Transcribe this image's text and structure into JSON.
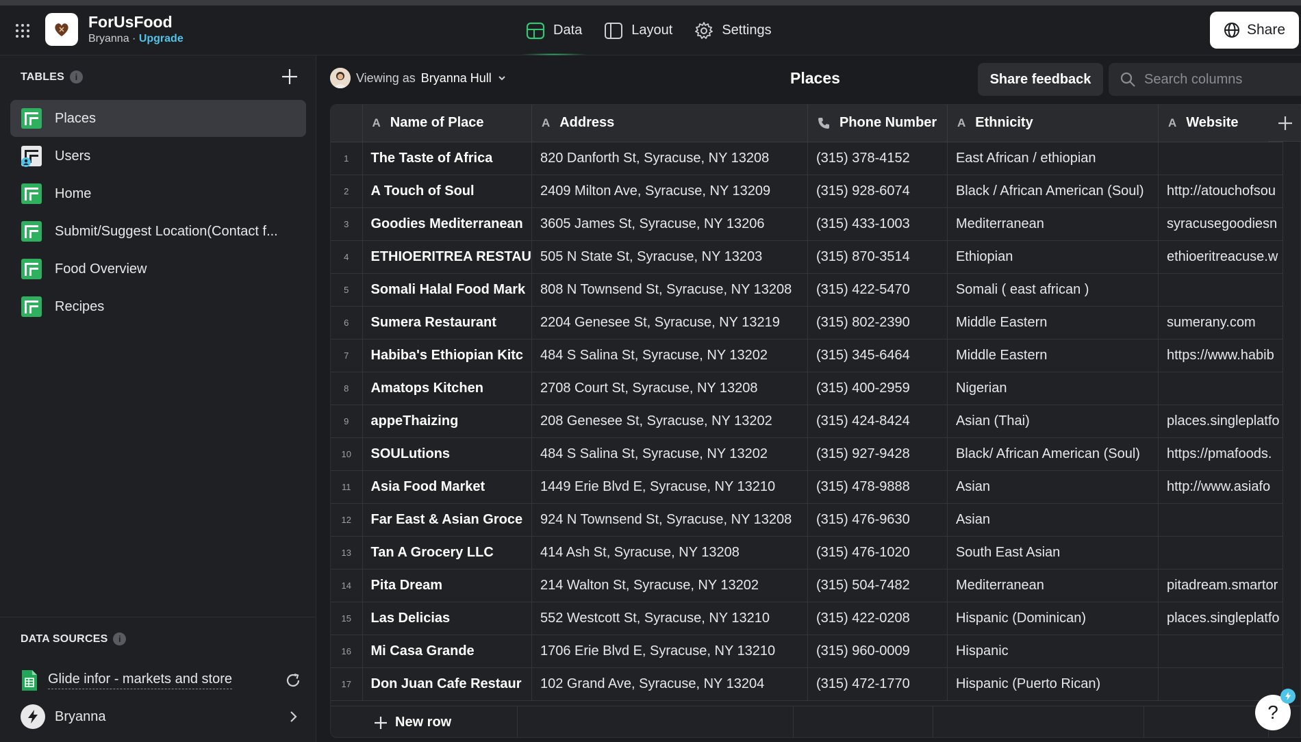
{
  "app": {
    "title": "ForUsFood",
    "user": "Bryanna",
    "separator": " · ",
    "upgrade_label": "Upgrade"
  },
  "nav": {
    "tabs": [
      {
        "label": "Data",
        "icon": "table-icon",
        "active": true
      },
      {
        "label": "Layout",
        "icon": "layout-icon",
        "active": false
      },
      {
        "label": "Settings",
        "icon": "gear-icon",
        "active": false
      }
    ],
    "share_label": "Share"
  },
  "sidebar": {
    "tables_heading": "TABLES",
    "tables": [
      {
        "label": "Places",
        "active": true
      },
      {
        "label": "Users",
        "active": false
      },
      {
        "label": "Home",
        "active": false
      },
      {
        "label": "Submit/Suggest Location(Contact f...",
        "active": false
      },
      {
        "label": "Food Overview",
        "active": false
      },
      {
        "label": "Recipes",
        "active": false
      }
    ],
    "data_sources_heading": "DATA SOURCES",
    "data_source": {
      "label": "Glide infor - markets and store",
      "icon": "google-sheets-icon"
    },
    "user_label": "Bryanna"
  },
  "main": {
    "viewing_prefix": "Viewing as ",
    "viewing_name": "Bryanna Hull",
    "page_title": "Places",
    "feedback_label": "Share feedback",
    "search_placeholder": "Search columns"
  },
  "grid": {
    "columns": [
      {
        "label": "Name of Place",
        "type_icon": "text-type-icon"
      },
      {
        "label": "Address",
        "type_icon": "text-type-icon"
      },
      {
        "label": "Phone Number",
        "type_icon": "phone-icon"
      },
      {
        "label": "Ethnicity",
        "type_icon": "text-type-icon"
      },
      {
        "label": "Website",
        "type_icon": "text-type-icon"
      }
    ],
    "rows": [
      {
        "n": "1",
        "name": "The Taste of Africa",
        "address": "820 Danforth St, Syracuse, NY 13208",
        "phone": "(315) 378-4152",
        "ethnicity": "East African / ethiopian",
        "website": ""
      },
      {
        "n": "2",
        "name": "A Touch of Soul",
        "address": "2409 Milton Ave, Syracuse, NY 13209",
        "phone": "(315) 928-6074",
        "ethnicity": "Black / African American (Soul)",
        "website": "http://atouchofsou"
      },
      {
        "n": "3",
        "name": "Goodies Mediterranean",
        "address": "3605 James St, Syracuse, NY 13206",
        "phone": "(315) 433-1003",
        "ethnicity": "Mediterranean",
        "website": "syracusegoodiesn"
      },
      {
        "n": "4",
        "name": "ETHIOERITREA RESTAU",
        "address": "505 N State St, Syracuse, NY 13203",
        "phone": "(315) 870-3514",
        "ethnicity": "Ethiopian",
        "website": "ethioeritreacuse.w"
      },
      {
        "n": "5",
        "name": "Somali Halal Food Mark",
        "address": "808 N Townsend St, Syracuse, NY 13208",
        "phone": "(315) 422-5470",
        "ethnicity": "Somali ( east african )",
        "website": ""
      },
      {
        "n": "6",
        "name": "Sumera Restaurant",
        "address": "2204 Genesee St, Syracuse, NY 13219",
        "phone": "(315) 802-2390",
        "ethnicity": "Middle Eastern",
        "website": "sumerany.com"
      },
      {
        "n": "7",
        "name": "Habiba's Ethiopian Kitc",
        "address": "484 S Salina St, Syracuse, NY 13202",
        "phone": "(315) 345-6464",
        "ethnicity": "Middle Eastern",
        "website": "https://www.habib"
      },
      {
        "n": "8",
        "name": "Amatops Kitchen",
        "address": "2708 Court St, Syracuse, NY 13208",
        "phone": "(315) 400-2959",
        "ethnicity": "Nigerian",
        "website": ""
      },
      {
        "n": "9",
        "name": "appeThaizing",
        "address": "208 Genesee St, Syracuse, NY 13202",
        "phone": "(315) 424-8424",
        "ethnicity": "Asian (Thai)",
        "website": "places.singleplatfo"
      },
      {
        "n": "10",
        "name": "SOULutions",
        "address": "484 S Salina St, Syracuse, NY 13202",
        "phone": "(315) 927-9428",
        "ethnicity": "Black/ African American (Soul)",
        "website": "https://pmafoods."
      },
      {
        "n": "11",
        "name": "Asia Food Market",
        "address": " 1449 Erie Blvd E, Syracuse, NY 13210",
        "phone": "(315) 478-9888",
        "ethnicity": "Asian",
        "website": "http://www.asiafo"
      },
      {
        "n": "12",
        "name": "Far East & Asian Groce",
        "address": "924 N Townsend St, Syracuse, NY 13208",
        "phone": "(315) 476-9630",
        "ethnicity": "Asian",
        "website": ""
      },
      {
        "n": "13",
        "name": "Tan A  Grocery LLC",
        "address": "414 Ash St, Syracuse, NY 13208",
        "phone": "(315) 476-1020",
        "ethnicity": "South East Asian",
        "website": ""
      },
      {
        "n": "14",
        "name": "Pita Dream",
        "address": "214 Walton St, Syracuse, NY 13202",
        "phone": "(315) 504-7482",
        "ethnicity": "Mediterranean",
        "website": "pitadream.smartor"
      },
      {
        "n": "15",
        "name": "Las Delicias",
        "address": "552 Westcott St, Syracuse, NY 13210",
        "phone": "(315) 422-0208",
        "ethnicity": "Hispanic (Dominican)",
        "website": "places.singleplatfo"
      },
      {
        "n": "16",
        "name": "Mi Casa Grande",
        "address": "1706 Erie Blvd E, Syracuse, NY 13210",
        "phone": "(315) 960-0009",
        "ethnicity": "Hispanic",
        "website": ""
      },
      {
        "n": "17",
        "name": "Don Juan Cafe Restaur",
        "address": "102 Grand Ave, Syracuse, NY 13204",
        "phone": "(315) 472-1770",
        "ethnicity": "Hispanic (Puerto Rican)",
        "website": ""
      }
    ],
    "new_row_label": "New row"
  },
  "help_label": "?",
  "colors": {
    "accent_green": "#34c771",
    "link_blue": "#4fc3e8",
    "bg": "#1b1c1f"
  }
}
